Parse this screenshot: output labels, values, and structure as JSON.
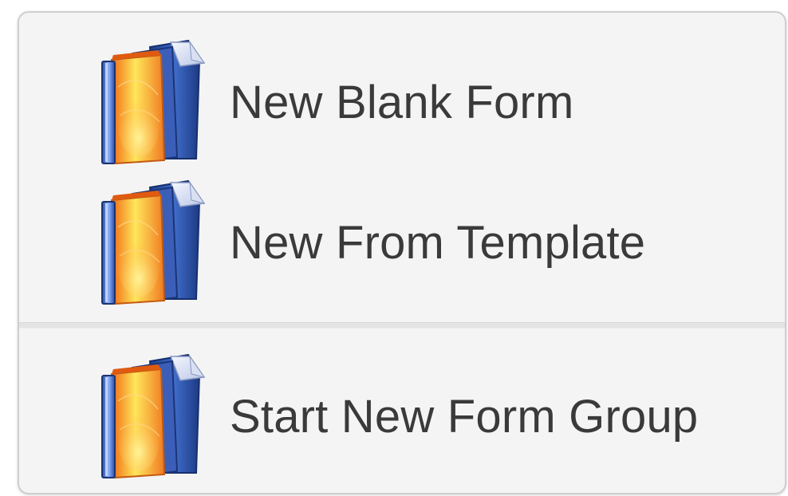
{
  "menu": {
    "items": [
      {
        "label": "New Blank Form",
        "icon": "form-binder-icon"
      },
      {
        "label": "New From Template",
        "icon": "form-binder-icon"
      }
    ],
    "group2": [
      {
        "label": "Start New Form Group",
        "icon": "form-binder-icon"
      }
    ]
  },
  "colors": {
    "menu_background": "#f4f4f4",
    "label_text": "#3a3a3a",
    "separator": "#e4e4e4",
    "binder_blue": "#2b4fa0",
    "binder_orange": "#f07820",
    "binder_yellow": "#ffe84a"
  }
}
